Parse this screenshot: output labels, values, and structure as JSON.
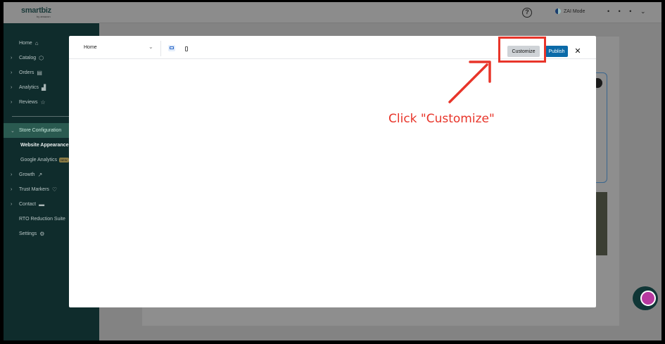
{
  "app": {
    "logo_text": "smartbiz",
    "logo_sub": "by amazon",
    "help_symbol": "?",
    "zai_mode_label": "ZAI Mode",
    "user_dots": "• • •",
    "user_chevron": "⌄"
  },
  "sidebar": {
    "items": [
      {
        "label": "Home",
        "icon": "home-icon",
        "glyph": "⌂"
      },
      {
        "label": "Catalog",
        "icon": "box-icon",
        "glyph": "⬡"
      },
      {
        "label": "Orders",
        "icon": "clipboard-icon",
        "glyph": "▤"
      },
      {
        "label": "Analytics",
        "icon": "bar-chart-icon",
        "glyph": "▟"
      },
      {
        "label": "Reviews",
        "icon": "star-icon",
        "glyph": "☆"
      }
    ],
    "store_config": {
      "label": "Store Configuration"
    },
    "sub_items": [
      {
        "label": "Website Appearance"
      },
      {
        "label": "Google Analytics",
        "badge": "NEW"
      }
    ],
    "more_items": [
      {
        "label": "Growth",
        "icon": "trend-icon",
        "glyph": "↗"
      },
      {
        "label": "Trust Markers",
        "icon": "heart-icon",
        "glyph": "♡"
      },
      {
        "label": "Contact",
        "icon": "chat-icon",
        "glyph": "▬"
      },
      {
        "label": "RTO Reduction Suite"
      },
      {
        "label": "Settings",
        "icon": "gear-icon",
        "glyph": "⚙"
      }
    ]
  },
  "modal": {
    "page_select_value": "Home",
    "customize_label": "Customize",
    "publish_label": "Publish",
    "close_symbol": "✕"
  },
  "annotation": {
    "hint_text": "Click \"Customize\"",
    "accent_color": "#e8352a"
  }
}
